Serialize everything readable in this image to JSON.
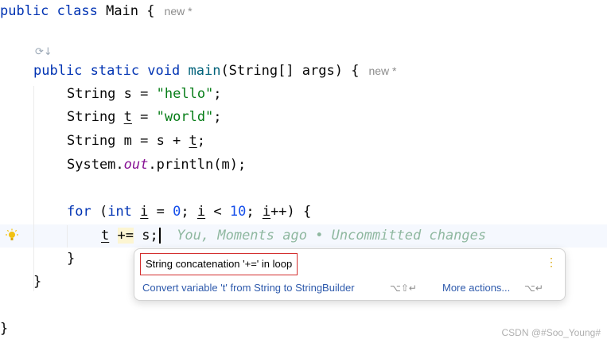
{
  "editor": {
    "class_kw": "public class",
    "class_name": "Main",
    "open_brace": "{",
    "class_hint": "new *",
    "gutter_glyph": "⟳↓",
    "method_prefix": "public static void",
    "method_name": "main",
    "method_params": "(String[] args) {",
    "method_hint": "new *",
    "line_s": {
      "type": "String",
      "var": "s",
      "eq": " = ",
      "value": "\"hello\"",
      "end": ";"
    },
    "line_t": {
      "type": "String",
      "var": "t",
      "eq": " = ",
      "value": "\"world\"",
      "end": ";"
    },
    "line_m": {
      "pre": "String m = s + ",
      "var": "t",
      "end": ";"
    },
    "line_print": {
      "pre": "System.",
      "field": "out",
      "post": ".println(m);"
    },
    "for_line": {
      "for_kw": "for",
      "p1": " (",
      "int_kw": "int",
      "i1": "i",
      "p2": " = ",
      "zero": "0",
      "p3": "; ",
      "i2": "i",
      "p4": " < ",
      "ten": "10",
      "p5": "; ",
      "i3": "i",
      "p6": "++) {"
    },
    "concat_line": {
      "var": "t",
      "op": "+=",
      "rest": " s;"
    },
    "blame": "You, Moments ago • Uncommitted changes",
    "close_inner": "}",
    "close_method": "}",
    "close_class": "}"
  },
  "popup": {
    "problem": "String concatenation '+=' in loop",
    "menu_dots": "⋮",
    "fix_action": "Convert variable 't' from String to StringBuilder",
    "fix_shortcut": "⌥⇧↵",
    "more_actions": "More actions...",
    "more_shortcut": "⌥↵"
  },
  "watermark": "CSDN @#Soo_Young#",
  "colors": {
    "keyword": "#0033b3",
    "string": "#067d17",
    "number": "#1750eb",
    "field": "#871094",
    "link": "#2e5aac",
    "problem_border": "#d32f2f"
  }
}
